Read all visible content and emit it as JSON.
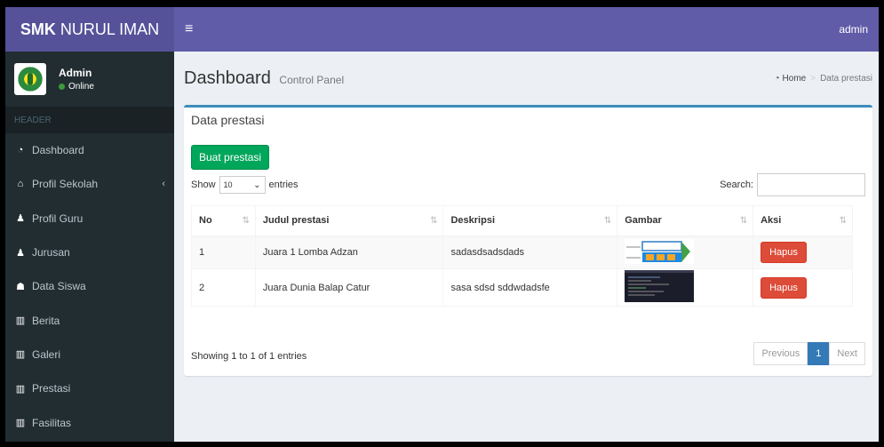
{
  "logo": {
    "bold": "SMK",
    "rest": "NURUL IMAN"
  },
  "navbar": {
    "toggle_icon": "≡",
    "user": "admin"
  },
  "sidebar": {
    "user_name": "Admin",
    "user_status": "Online",
    "header": "HEADER",
    "items": [
      {
        "icon": "dashboard-icon",
        "label": "Dashboard"
      },
      {
        "icon": "school-icon",
        "label": "Profil Sekolah"
      },
      {
        "icon": "user-icon",
        "label": "Profil Guru"
      },
      {
        "icon": "user-icon",
        "label": "Jurusan"
      },
      {
        "icon": "users-icon",
        "label": "Data Siswa"
      },
      {
        "icon": "map-icon",
        "label": "Berita"
      },
      {
        "icon": "map-icon",
        "label": "Galeri"
      },
      {
        "icon": "map-icon",
        "label": "Prestasi"
      },
      {
        "icon": "map-icon",
        "label": "Fasilitas"
      }
    ]
  },
  "header": {
    "title": "Dashboard",
    "subtitle": "Control Panel",
    "breadcrumb_home": "Home",
    "breadcrumb_current": "Data prestasi"
  },
  "box": {
    "title": "Data prestasi",
    "add_button": "Buat prestasi",
    "show_label": "Show",
    "entries_value": "10",
    "entries_label": "entries",
    "search_label": "Search:"
  },
  "table": {
    "headers": [
      "No",
      "Judul prestasi",
      "Deskripsi",
      "Gambar",
      "Aksi"
    ],
    "rows": [
      {
        "no": "1",
        "judul": "Juara 1 Lomba Adzan",
        "deskripsi": "sadasdsadsdads",
        "aksi": "Hapus"
      },
      {
        "no": "2",
        "judul": "Juara Dunia Balap Catur",
        "deskripsi": "sasa sdsd sddwdadsfe",
        "aksi": "Hapus"
      }
    ]
  },
  "footer": {
    "info": "Showing 1 to 1 of 1 entries",
    "prev": "Previous",
    "page": "1",
    "next": "Next"
  },
  "colors": {
    "header_purple": "#605ca8",
    "sidebar_dark": "#222d32",
    "success": "#00a65a",
    "danger": "#dd4b39",
    "primary": "#337ab7"
  }
}
